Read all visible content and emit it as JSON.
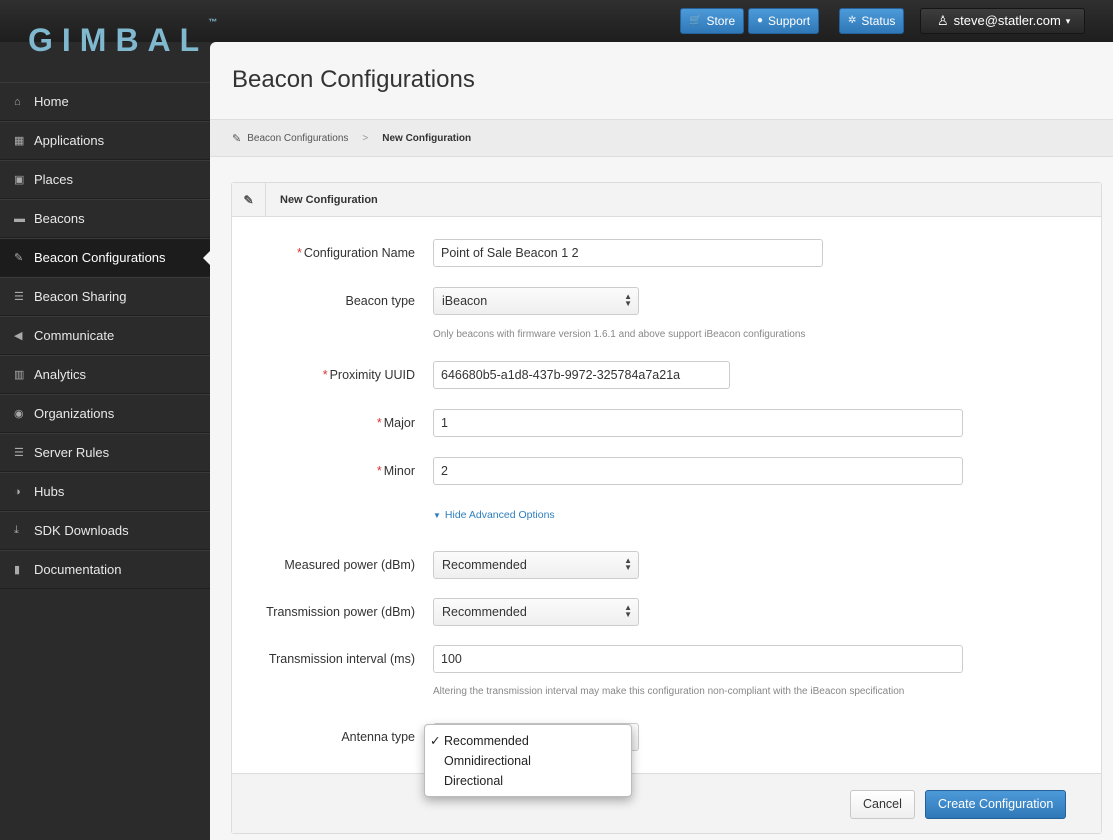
{
  "brand": {
    "logo": "GIMBAL",
    "tm": "™"
  },
  "topbar": {
    "store": {
      "icon": "cart-icon",
      "label": "Store"
    },
    "support": {
      "icon": "help-icon",
      "label": "Support"
    },
    "status": {
      "icon": "status-icon",
      "label": "Status"
    },
    "user": {
      "icon": "user-icon",
      "label": "steve@statler.com"
    }
  },
  "sidebar": {
    "items": [
      {
        "icon": "home-icon",
        "glyph": "⌂",
        "label": "Home"
      },
      {
        "icon": "grid-icon",
        "glyph": "▦",
        "label": "Applications"
      },
      {
        "icon": "image-icon",
        "glyph": "▣",
        "label": "Places"
      },
      {
        "icon": "beacon-icon",
        "glyph": "▬",
        "label": "Beacons"
      },
      {
        "icon": "wrench-icon",
        "glyph": "✎",
        "label": "Beacon Configurations",
        "active": true
      },
      {
        "icon": "list-icon",
        "glyph": "☰",
        "label": "Beacon Sharing"
      },
      {
        "icon": "megaphone-icon",
        "glyph": "◀",
        "label": "Communicate"
      },
      {
        "icon": "chart-icon",
        "glyph": "▥",
        "label": "Analytics"
      },
      {
        "icon": "globe-icon",
        "glyph": "◉",
        "label": "Organizations"
      },
      {
        "icon": "rules-icon",
        "glyph": "☰",
        "label": "Server Rules"
      },
      {
        "icon": "hub-icon",
        "glyph": "◑",
        "label": "Hubs"
      },
      {
        "icon": "download-icon",
        "glyph": "⤓",
        "label": "SDK Downloads"
      },
      {
        "icon": "book-icon",
        "glyph": "▮",
        "label": "Documentation"
      }
    ]
  },
  "page": {
    "title": "Beacon Configurations",
    "breadcrumb": {
      "parent": "Beacon Configurations",
      "sep": ">",
      "current": "New Configuration"
    }
  },
  "form": {
    "heading": "New Configuration",
    "config_name": {
      "label": "Configuration Name",
      "required": "*",
      "value": "Point of Sale Beacon 1 2"
    },
    "beacon_type": {
      "label": "Beacon type",
      "value": "iBeacon",
      "help": "Only beacons with firmware version 1.6.1 and above support iBeacon configurations"
    },
    "uuid": {
      "label": "Proximity UUID",
      "required": "*",
      "value": "646680b5-a1d8-437b-9972-325784a7a21a"
    },
    "major": {
      "label": "Major",
      "required": "*",
      "value": "1"
    },
    "minor": {
      "label": "Minor",
      "required": "*",
      "value": "2"
    },
    "advanced_link": "Hide Advanced Options",
    "measured_power": {
      "label": "Measured power (dBm)",
      "value": "Recommended"
    },
    "tx_power": {
      "label": "Transmission power (dBm)",
      "value": "Recommended"
    },
    "tx_interval": {
      "label": "Transmission interval (ms)",
      "value": "100",
      "help": "Altering the transmission interval may make this configuration non-compliant with the iBeacon specification"
    },
    "antenna": {
      "label": "Antenna type",
      "options": [
        "Recommended",
        "Omnidirectional",
        "Directional"
      ],
      "selected": "Recommended",
      "check": "✓"
    }
  },
  "actions": {
    "cancel": "Cancel",
    "create": "Create Configuration"
  }
}
